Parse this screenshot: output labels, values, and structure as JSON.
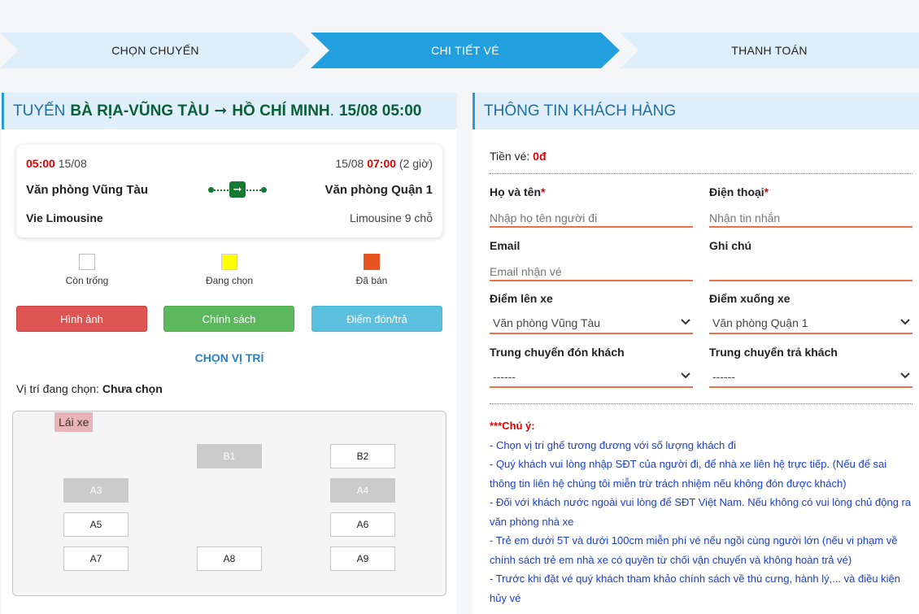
{
  "steps": [
    "CHỌN CHUYẾN",
    "CHI TIẾT VÉ",
    "THANH TOÁN"
  ],
  "route": {
    "prefix": "TUYẾN",
    "name": "BÀ RỊA-VŨNG TÀU",
    "arrow": "➞",
    "destination": "HỒ CHÍ MINH",
    "dot": ".",
    "datetime": "15/08 05:00"
  },
  "trip": {
    "depart_time": "05:00",
    "depart_date": "15/08",
    "arrive_date": "15/08",
    "arrive_time": "07:00",
    "duration": "(2 giờ)",
    "from": "Văn phòng Vũng Tàu",
    "to": "Văn phòng Quận 1",
    "operator": "Vie Limousine",
    "vehicle": "Limousine 9 chỗ",
    "bus_glyph": "➞"
  },
  "legend": {
    "empty": "Còn trống",
    "selecting": "Đang chọn",
    "sold": "Đã bán",
    "colors": {
      "empty": "#ffffff",
      "selecting": "#ffff00",
      "sold": "#e75420"
    }
  },
  "buttons": {
    "images": "Hình ảnh",
    "policy": "Chính sách",
    "pickup": "Điểm đón/trả"
  },
  "choose_seat": "CHỌN VỊ TRÍ",
  "current_seat": {
    "label": "Vị trí đang chọn:",
    "value": "Chưa chọn"
  },
  "seatmap": {
    "driver": "Lái xe",
    "seats": [
      {
        "label": "B1",
        "status": "sold"
      },
      {
        "label": "B2",
        "status": "empty"
      },
      {
        "label": "A3",
        "status": "sold"
      },
      {
        "label": "A4",
        "status": "sold"
      },
      {
        "label": "A5",
        "status": "empty"
      },
      {
        "label": "A6",
        "status": "empty"
      },
      {
        "label": "A7",
        "status": "empty"
      },
      {
        "label": "A8",
        "status": "empty"
      },
      {
        "label": "A9",
        "status": "empty"
      }
    ]
  },
  "customer": {
    "title": "THÔNG TIN KHÁCH HÀNG",
    "price_label": "Tiền vé:",
    "price_value": "0đ",
    "name_label": "Họ và tên",
    "name_placeholder": "Nhập họ tên người đi",
    "phone_label": "Điện thoại",
    "phone_placeholder": "Nhận tin nhắn",
    "required_mark": "*",
    "email_label": "Email",
    "email_placeholder": "Email nhận vé",
    "note_label": "Ghi chú",
    "note_placeholder": "",
    "pickup_label": "Điểm lên xe",
    "pickup_value": "Văn phòng Vũng Tàu",
    "dropoff_label": "Điểm xuống xe",
    "dropoff_value": "Văn phòng Quận 1",
    "transfer_pick_label": "Trung chuyển đón khách",
    "transfer_pick_value": "------",
    "transfer_drop_label": "Trung chuyển trả khách",
    "transfer_drop_value": "------"
  },
  "notes": {
    "title": "***Chú ý:",
    "items": [
      "- Chọn vị trí ghế tương đương với số lượng khách đi",
      "- Quý khách vui lòng nhập SĐT của người đi, để nhà xe liên hệ trực tiếp. (Nếu để sai thông tin liên hệ chúng tôi miễn trừ trách nhiệm nếu không đón được khách)",
      "- Đối với khách nước ngoài vui lòng để SĐT Việt Nam. Nếu không có vui lòng chủ động ra văn phòng nhà xe",
      "- Trẻ em dưới 5T và dưới 100cm miễn phí vé nếu ngồi cùng người lớn (nếu vi phạm về chính sách trẻ em nhà xe có quyền từ chối vận chuyển và không hoàn trả vé)",
      "- Trước khi đặt vé quý khách tham khảo chính sách về thú cưng, hành lý,... và điều kiện hủy vé"
    ]
  }
}
